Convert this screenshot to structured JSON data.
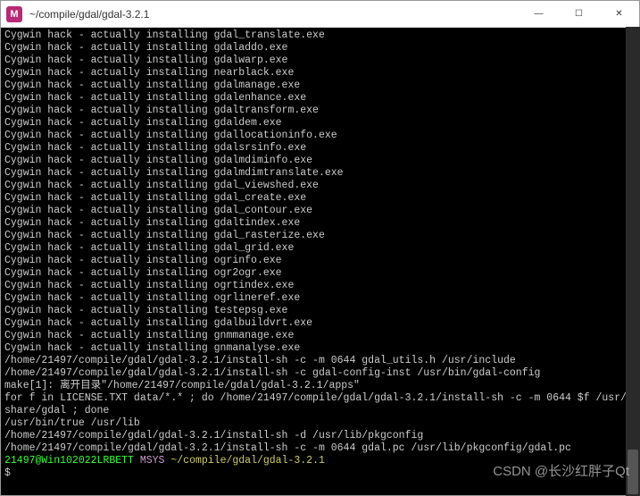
{
  "titlebar": {
    "icon_letter": "M",
    "title": "~/compile/gdal/gdal-3.2.1",
    "minimize": "—",
    "maximize": "☐",
    "close": "✕"
  },
  "hack_prefix": "Cygwin hack - actually installing ",
  "hack_files": [
    "gdal_translate.exe",
    "gdaladdo.exe",
    "gdalwarp.exe",
    "nearblack.exe",
    "gdalmanage.exe",
    "gdalenhance.exe",
    "gdaltransform.exe",
    "gdaldem.exe",
    "gdallocationinfo.exe",
    "gdalsrsinfo.exe",
    "gdalmdiminfo.exe",
    "gdalmdimtranslate.exe",
    "gdal_viewshed.exe",
    "gdal_create.exe",
    "gdal_contour.exe",
    "gdaltindex.exe",
    "gdal_rasterize.exe",
    "gdal_grid.exe",
    "ogrinfo.exe",
    "ogr2ogr.exe",
    "ogrtindex.exe",
    "ogrlineref.exe",
    "testepsg.exe",
    "gdalbuildvrt.exe",
    "gnmmanage.exe",
    "gnmanalyse.exe"
  ],
  "tail_lines": [
    "/home/21497/compile/gdal/gdal-3.2.1/install-sh -c -m 0644 gdal_utils.h /usr/include",
    "/home/21497/compile/gdal/gdal-3.2.1/install-sh -c gdal-config-inst /usr/bin/gdal-config",
    "make[1]: 离开目录\"/home/21497/compile/gdal/gdal-3.2.1/apps\"",
    "for f in LICENSE.TXT data/*.* ; do /home/21497/compile/gdal/gdal-3.2.1/install-sh -c -m 0644 $f /usr/",
    "share/gdal ; done",
    "/usr/bin/true /usr/lib",
    "/home/21497/compile/gdal/gdal-3.2.1/install-sh -d /usr/lib/pkgconfig",
    "/home/21497/compile/gdal/gdal-3.2.1/install-sh -c -m 0644 gdal.pc /usr/lib/pkgconfig/gdal.pc",
    ""
  ],
  "prompt": {
    "user": "21497@Win102022LRBETT",
    "msys": "MSYS",
    "path": "~/compile/gdal/gdal-3.2.1",
    "dollar": "$"
  },
  "watermark": "CSDN @长沙红胖子Qt"
}
